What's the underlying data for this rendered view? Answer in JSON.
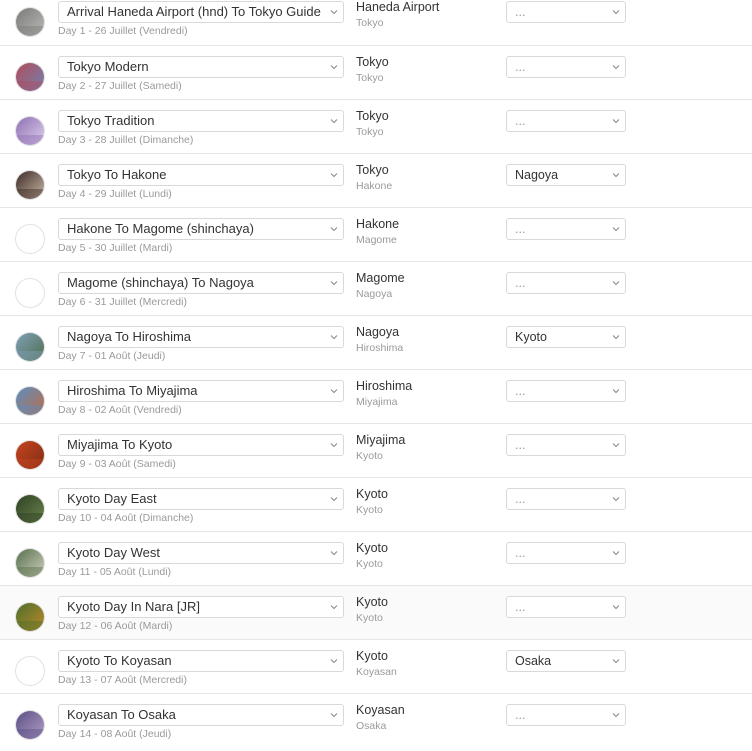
{
  "days": [
    {
      "title": "Arrival Haneda Airport (hnd) To Tokyo Guide",
      "date": "Day 1 - 26 Juillet (Vendredi)",
      "from": "Haneda Airport",
      "to": "Tokyo",
      "via": "...",
      "photo": true,
      "colors": [
        "#7a7a78",
        "#bfbfbc"
      ]
    },
    {
      "title": "Tokyo Modern",
      "date": "Day 2 - 27 Juillet (Samedi)",
      "from": "Tokyo",
      "to": "Tokyo",
      "via": "...",
      "photo": true,
      "colors": [
        "#b04a5a",
        "#6f88b8"
      ]
    },
    {
      "title": "Tokyo Tradition",
      "date": "Day 3 - 28 Juillet (Dimanche)",
      "from": "Tokyo",
      "to": "Tokyo",
      "via": "...",
      "photo": true,
      "colors": [
        "#8e6fb4",
        "#e4d8ef"
      ]
    },
    {
      "title": "Tokyo To Hakone",
      "date": "Day 4 - 29 Juillet (Lundi)",
      "from": "Tokyo",
      "to": "Hakone",
      "via": "Nagoya",
      "photo": true,
      "colors": [
        "#3b2a24",
        "#d6c3b4"
      ]
    },
    {
      "title": "Hakone To Magome (shinchaya)",
      "date": "Day 5 - 30 Juillet (Mardi)",
      "from": "Hakone",
      "to": "Magome",
      "via": "...",
      "photo": false,
      "colors": [
        "#ffffff",
        "#ffffff"
      ]
    },
    {
      "title": "Magome (shinchaya) To Nagoya",
      "date": "Day 6 - 31 Juillet (Mercredi)",
      "from": "Magome",
      "to": "Nagoya",
      "via": "...",
      "photo": false,
      "colors": [
        "#ffffff",
        "#ffffff"
      ]
    },
    {
      "title": "Nagoya To Hiroshima",
      "date": "Day 7 - 01 Août (Jeudi)",
      "from": "Nagoya",
      "to": "Hiroshima",
      "via": "Kyoto",
      "photo": true,
      "colors": [
        "#7f9fb5",
        "#4d6b4a"
      ]
    },
    {
      "title": "Hiroshima To Miyajima",
      "date": "Day 8 - 02 Août (Vendredi)",
      "from": "Hiroshima",
      "to": "Miyajima",
      "via": "...",
      "photo": true,
      "colors": [
        "#5b8fc4",
        "#c46a3b"
      ]
    },
    {
      "title": "Miyajima To Kyoto",
      "date": "Day 9 - 03 Août (Samedi)",
      "from": "Miyajima",
      "to": "Kyoto",
      "via": "...",
      "photo": true,
      "colors": [
        "#c6451f",
        "#7a2a14"
      ]
    },
    {
      "title": "Kyoto Day East",
      "date": "Day 10 - 04 Août (Dimanche)",
      "from": "Kyoto",
      "to": "Kyoto",
      "via": "...",
      "photo": true,
      "colors": [
        "#2e3f24",
        "#6f8a4f"
      ]
    },
    {
      "title": "Kyoto Day West",
      "date": "Day 11 - 05 Août (Lundi)",
      "from": "Kyoto",
      "to": "Kyoto",
      "via": "...",
      "photo": true,
      "colors": [
        "#56704a",
        "#d9d6c9"
      ]
    },
    {
      "title": "Kyoto Day In Nara [JR]",
      "date": "Day 12 - 06 Août (Mardi)",
      "from": "Kyoto",
      "to": "Kyoto",
      "via": "...",
      "photo": true,
      "colors": [
        "#4d6f2c",
        "#c38a2a"
      ]
    },
    {
      "title": "Kyoto To Koyasan",
      "date": "Day 13 - 07 Août (Mercredi)",
      "from": "Kyoto",
      "to": "Koyasan",
      "via": "Osaka",
      "photo": false,
      "colors": [
        "#ffffff",
        "#ffffff"
      ]
    },
    {
      "title": "Koyasan To Osaka",
      "date": "Day 14 - 08 Août (Jeudi)",
      "from": "Koyasan",
      "to": "Osaka",
      "via": "...",
      "photo": true,
      "colors": [
        "#5a4e86",
        "#b8a6c9"
      ]
    }
  ]
}
